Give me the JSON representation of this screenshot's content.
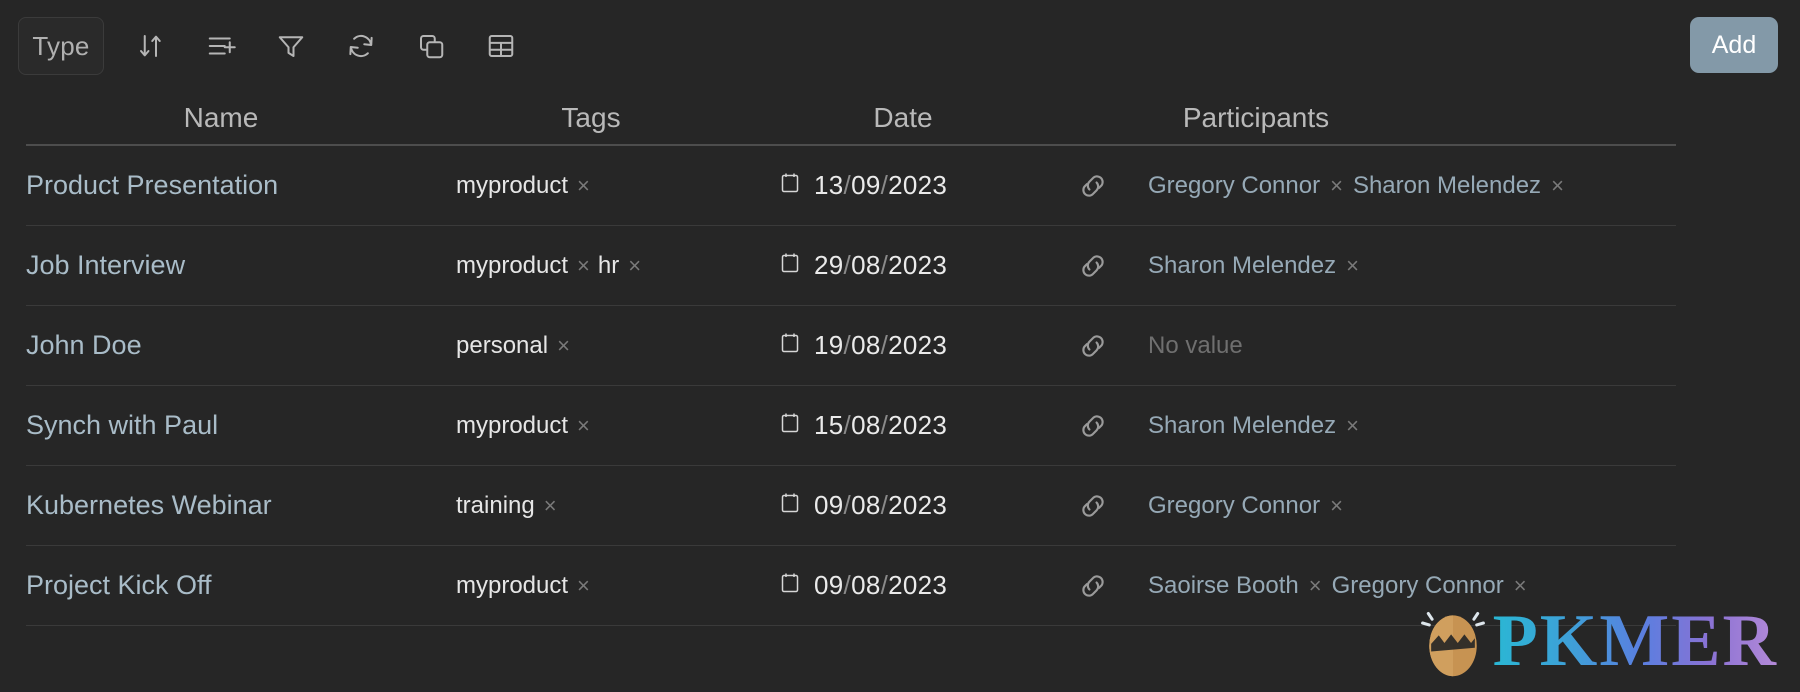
{
  "toolbar": {
    "type_label": "Type",
    "add_label": "Add",
    "icons": [
      {
        "name": "sort-icon",
        "title": "Sort"
      },
      {
        "name": "add-row-icon",
        "title": "Insert row"
      },
      {
        "name": "filter-icon",
        "title": "Filter"
      },
      {
        "name": "refresh-icon",
        "title": "Refresh"
      },
      {
        "name": "copy-icon",
        "title": "Duplicate"
      },
      {
        "name": "table-icon",
        "title": "Table view"
      }
    ]
  },
  "table": {
    "headers": {
      "name": "Name",
      "tags": "Tags",
      "date": "Date",
      "participants": "Participants"
    },
    "no_value_text": "No value",
    "rows": [
      {
        "name": "Product Presentation",
        "tags": [
          "myproduct"
        ],
        "date": {
          "day": "13",
          "month": "09",
          "year": "2023"
        },
        "participants": [
          "Gregory Connor",
          "Sharon Melendez"
        ]
      },
      {
        "name": "Job Interview",
        "tags": [
          "myproduct",
          "hr"
        ],
        "date": {
          "day": "29",
          "month": "08",
          "year": "2023"
        },
        "participants": [
          "Sharon Melendez"
        ]
      },
      {
        "name": "John Doe",
        "tags": [
          "personal"
        ],
        "date": {
          "day": "19",
          "month": "08",
          "year": "2023"
        },
        "participants": []
      },
      {
        "name": "Synch with Paul",
        "tags": [
          "myproduct"
        ],
        "date": {
          "day": "15",
          "month": "08",
          "year": "2023"
        },
        "participants": [
          "Sharon Melendez"
        ]
      },
      {
        "name": "Kubernetes Webinar",
        "tags": [
          "training"
        ],
        "date": {
          "day": "09",
          "month": "08",
          "year": "2023"
        },
        "participants": [
          "Gregory Connor"
        ]
      },
      {
        "name": "Project Kick Off",
        "tags": [
          "myproduct"
        ],
        "date": {
          "day": "09",
          "month": "08",
          "year": "2023"
        },
        "participants": [
          "Saoirse Booth",
          "Gregory Connor"
        ]
      }
    ]
  },
  "watermark": {
    "text": "PKMER"
  },
  "colors": {
    "background": "#262626",
    "add_button": "#8399a8",
    "name_link": "#a9bcc8",
    "participant": "#96a9b6",
    "tag_text": "#e6e6e6",
    "muted": "#6f6f6f"
  }
}
